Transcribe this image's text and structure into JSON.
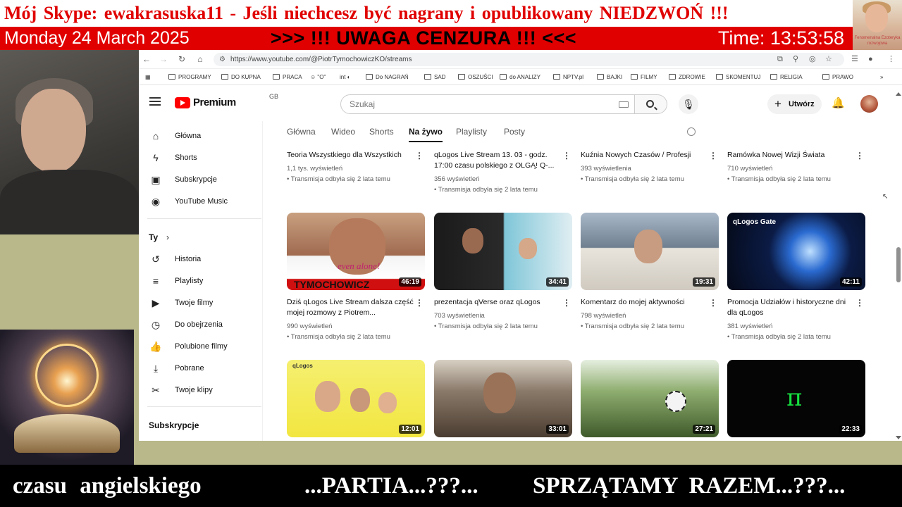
{
  "overlay": {
    "skype_banner": "Mój Skype: ewakrasuska11 - Jeśli  niechcesz  być  nagrany  i  opublikowany  NIEDZWOŃ !!!",
    "date": "Monday 24 March 2025",
    "warning": ">>> !!! UWAGA  CENZURA !!! <<<",
    "time": "Time: 13:53:58",
    "avatar_caption": "Fenomenalna Ezoteryka rozwojowa",
    "bottom_left": "czasu  angielskiego",
    "bottom_middle": "...PARTIA...???...",
    "bottom_right": "SPRZĄTAMY  RAZEM...???..."
  },
  "browser": {
    "url": "https://www.youtube.com/@PiotrTymochowiczKO/streams",
    "bookmarks": [
      "PROGRAMY",
      "DO KUPNA",
      "PRACA",
      "\"O\"",
      "Do NAGRAŃ",
      "SAD",
      "OSZUŚCI",
      "do ANALIZY",
      "NPTV.pl",
      "BAJKI",
      "FILMY",
      "ZDROWIE",
      "SKOMENTUJ",
      "RELIGIA",
      "PRAWO"
    ]
  },
  "youtube": {
    "logo_text": "Premium",
    "region": "GB",
    "search_placeholder": "Szukaj",
    "create_label": "Utwórz",
    "sidebar": {
      "main": [
        "Główna",
        "Shorts",
        "Subskrypcje",
        "YouTube Music"
      ],
      "you_heading": "Ty",
      "you_items": [
        "Historia",
        "Playlisty",
        "Twoje filmy",
        "Do obejrzenia",
        "Polubione filmy",
        "Pobrane",
        "Twoje klipy"
      ],
      "subs_heading": "Subskrypcje"
    },
    "tabs": [
      "Główna",
      "Wideo",
      "Shorts",
      "Na żywo",
      "Playlisty",
      "Posty"
    ],
    "active_tab": "Na żywo",
    "videos": [
      {
        "title": "Teoria Wszystkiego dla Wszystkich",
        "views": "1,1 tys. wyświetleń",
        "when": "Transmisja odbyła się 2 lata temu"
      },
      {
        "title": "qLogos Live Stream 13. 03 - godz. 17:00 czasu polskiego z OLGĄ! Q-...",
        "views": "356 wyświetleń",
        "when": "Transmisja odbyła się 2 lata temu"
      },
      {
        "title": "Kuźnia Nowych Czasów / Profesji",
        "views": "393 wyświetlenia",
        "when": "Transmisja odbyła się 2 lata temu"
      },
      {
        "title": "Ramówka Nowej Wizji Świata",
        "views": "710 wyświetleń",
        "when": "Transmisja odbyła się 2 lata temu"
      },
      {
        "title": "Dziś qLogos Live Stream dalsza część mojej rozmowy z Piotrem...",
        "views": "990 wyświetleń",
        "when": "Transmisja odbyła się 2 lata temu",
        "duration": "46:19",
        "thumb_text": "TYMOCHOWICZ",
        "thumb_script": "even alone!"
      },
      {
        "title": "prezentacja qVerse oraz qLogos",
        "views": "703 wyświetlenia",
        "when": "Transmisja odbyła się 2 lata temu",
        "duration": "34:41"
      },
      {
        "title": "Komentarz do mojej aktywności",
        "views": "798 wyświetleń",
        "when": "Transmisja odbyła się 2 lata temu",
        "duration": "19:31"
      },
      {
        "title": "Promocja Udziałów i historyczne dni dla qLogos",
        "views": "381 wyświetleń",
        "when": "Transmisja odbyła się 2 lata temu",
        "duration": "42:11",
        "thumb_text": "qLogos Gate"
      },
      {
        "duration": "12:01",
        "thumb_text": "qLogos"
      },
      {
        "duration": "33:01"
      },
      {
        "duration": "27:21"
      },
      {
        "duration": "22:33"
      }
    ]
  },
  "colors": {
    "youtube_red": "#ff0000",
    "banner_red": "#e00000"
  }
}
